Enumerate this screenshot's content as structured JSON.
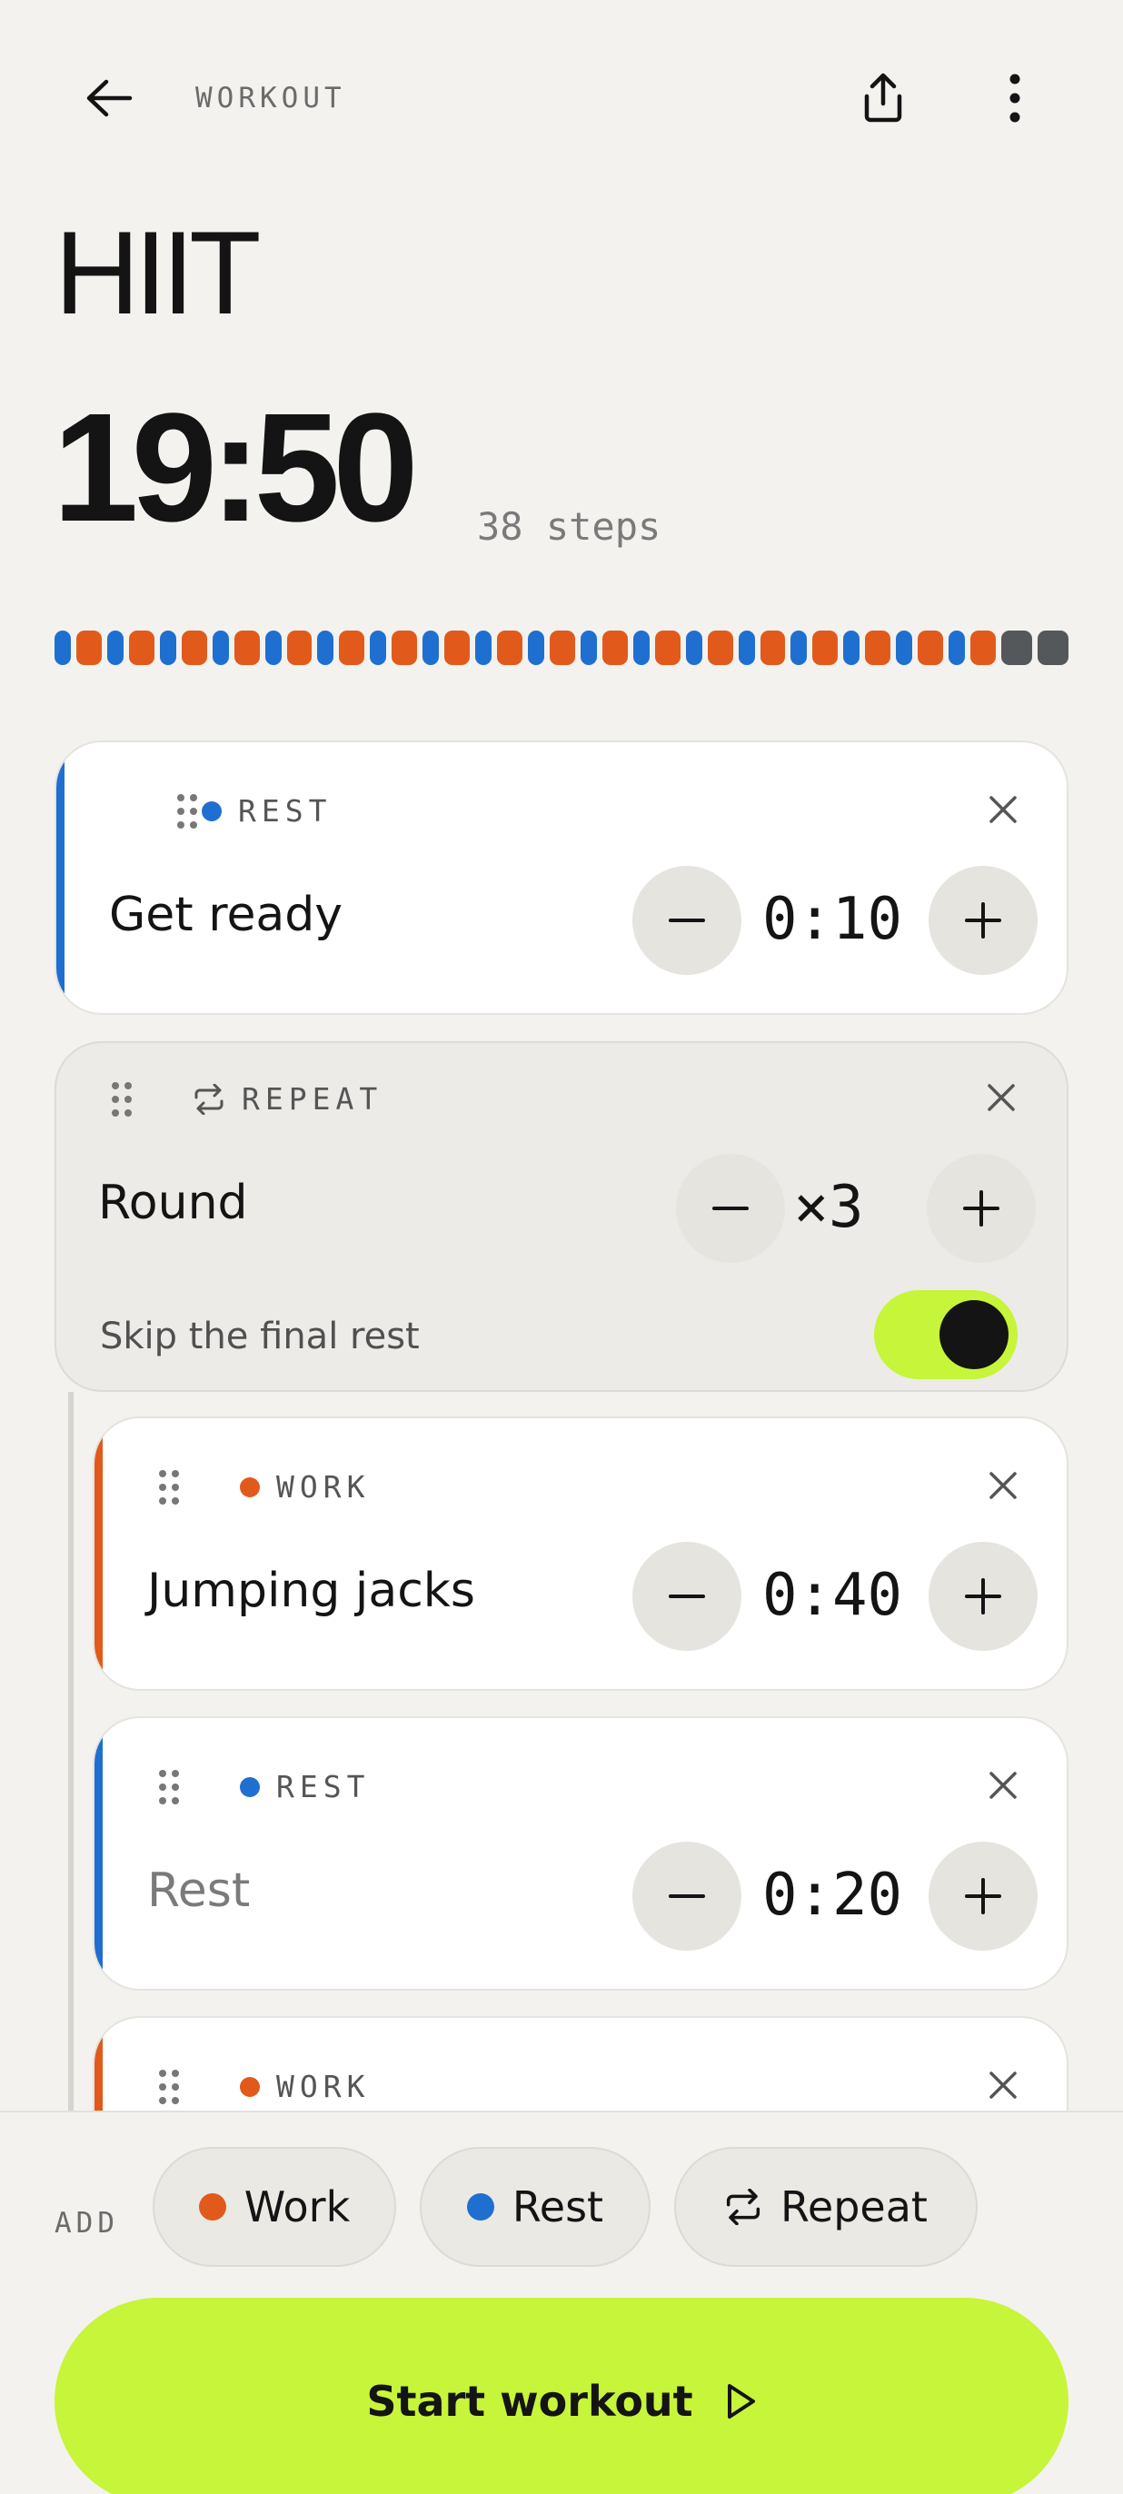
{
  "header": {
    "label": "WORKOUT",
    "back_icon": "arrow-left-icon",
    "share_icon": "share-icon",
    "more_icon": "more-vertical-icon"
  },
  "workout": {
    "title": "HIIT",
    "total_time": "19:50",
    "steps_label": "38 steps"
  },
  "progress": {
    "segments": [
      "rest",
      "work",
      "rest",
      "work",
      "rest",
      "work",
      "rest",
      "work",
      "rest",
      "work",
      "rest",
      "work",
      "rest",
      "work",
      "rest",
      "work",
      "rest",
      "work",
      "rest",
      "work",
      "rest",
      "work",
      "rest",
      "work",
      "rest",
      "work",
      "rest",
      "work",
      "rest",
      "work",
      "rest",
      "work",
      "rest",
      "work",
      "rest",
      "work",
      "end",
      "end"
    ]
  },
  "steps": [
    {
      "kind": "REST",
      "name": "Get ready",
      "value": "0:10"
    },
    {
      "kind": "REPEAT",
      "name": "Round",
      "value": "×3",
      "skip_label": "Skip the final rest",
      "skip_on": true
    },
    {
      "kind": "WORK",
      "name": "Jumping jacks",
      "value": "0:40"
    },
    {
      "kind": "REST",
      "name": "Rest",
      "value": "0:20"
    },
    {
      "kind": "WORK",
      "name": "",
      "value": ""
    }
  ],
  "add_bar": {
    "label": "ADD",
    "chips": [
      {
        "label": "Work",
        "icon": "work-dot-icon"
      },
      {
        "label": "Rest",
        "icon": "rest-dot-icon"
      },
      {
        "label": "Repeat",
        "icon": "repeat-icon"
      }
    ]
  },
  "start_button": {
    "label": "Start workout",
    "icon": "play-icon"
  },
  "colors": {
    "accent": "#c6f53a",
    "work": "#e15a1c",
    "rest": "#1f6fd0",
    "background": "#f3f2ef"
  }
}
